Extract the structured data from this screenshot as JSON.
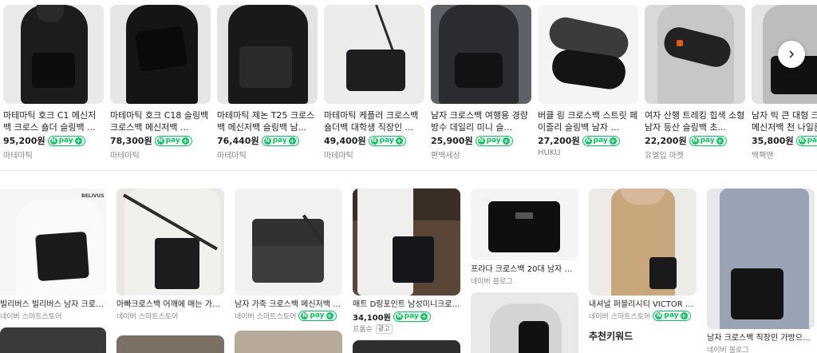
{
  "carousel": {
    "items": [
      {
        "title": "마테마틱 호크 C1 메신저백 크로스 숄더 슬링백 ...",
        "price": "95,200원",
        "store": "마테마틱",
        "npay": "pay"
      },
      {
        "title": "마테마틱 호크 C18 슬링백 크로스백 메신저백 ...",
        "price": "78,300원",
        "store": "마테마틱",
        "npay": "pay"
      },
      {
        "title": "마테마틱 제논 T25 크로스백 메신저백 슬링백 남...",
        "price": "76,440원",
        "store": "마테마틱",
        "npay": "pay"
      },
      {
        "title": "마테마틱 케플러 크로스백 숄더백 대학생 직장인 ...",
        "price": "49,400원",
        "store": "마테마틱",
        "npay": "pay"
      },
      {
        "title": "남자 크로스백 여행용 경량 방수 데일리 미니 슬...",
        "price": "25,900원",
        "store": "편백세상",
        "npay": "pay"
      },
      {
        "title": "버클 링 크로스백 스트릿 페이즐리 슬링백 남자 ...",
        "price": "27,200원",
        "store": "HUKU",
        "npay": "pay"
      },
      {
        "title": "여자 산행 트레킹 힙색 소형 남자 등산 슬링백 초...",
        "price": "22,200원",
        "store": "유엘입 마켓",
        "npay": "pay"
      },
      {
        "title": "남자 빅 큰 대형 크로스백 메신저백 천 나일론",
        "price": "35,800원",
        "store": "백팩맨",
        "npay": "pay"
      }
    ],
    "next_icon": "chevron-right-icon"
  },
  "grid": {
    "items": [
      {
        "title": "빌리버스 빌리버스 남자 크로스...",
        "store": "네이버 스마트스토어",
        "price": "",
        "brand_mark": "BELIVUS"
      },
      {
        "title": "아빠크로스백 어깨에 매는 가방 ...",
        "store": "네이버 스마트스토어",
        "price": ""
      },
      {
        "title": "남자 가죽 크로스백 메신저백 노...",
        "store": "네이버 스마트스토어",
        "price": "",
        "npay": "pay"
      },
      {
        "title": "매트 D링포인트 남성미니크로스...",
        "store": "프롬슈",
        "price": "34,100원",
        "npay": "pay",
        "ad": "광고"
      },
      {
        "title": "프라다 크로스백 20대 남자 가방",
        "store": "네이버 블로그",
        "price": ""
      },
      {
        "title": "내셔널 퍼블리시티 VICTOR HQ ...",
        "store": "네이버 스마트스토어",
        "price": "",
        "npay": "pay"
      },
      {
        "title": "남자 크로스백 직장인 가방으로 ...",
        "store": "네이버 블로그",
        "price": ""
      }
    ],
    "keyword_heading": "추천키워드"
  },
  "colors": {
    "npay_green": "#03c75a",
    "muted": "#888888",
    "divider": "#e4e4e4"
  }
}
